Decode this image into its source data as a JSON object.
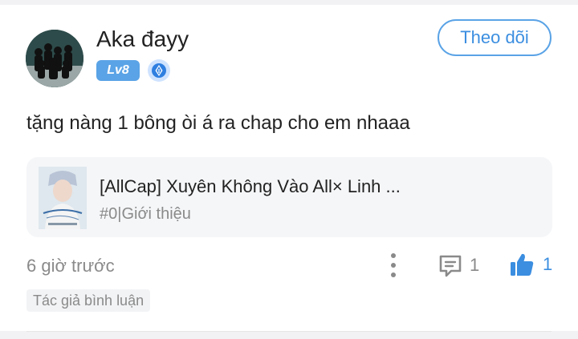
{
  "comment": {
    "username": "Aka đayy",
    "level": "Lv8",
    "follow_label": "Theo dõi",
    "text": "tặng nàng 1 bông òi á ra chap cho em nhaaa",
    "time": "6 giờ trước",
    "reply_count": "1",
    "like_count": "1",
    "author_tag": "Tác giả bình luận"
  },
  "linked_story": {
    "title": "[AllCap] Xuyên Không Vào All× Linh ...",
    "subtitle": "#0|Giới thiệu"
  },
  "icons": {
    "level_badge": "pen-nib-icon",
    "more": "more-vertical-icon",
    "reply": "comment-icon",
    "like": "thumbs-up-icon"
  },
  "colors": {
    "accent": "#3b8ee0",
    "badge": "#5aa3e6",
    "muted_text": "#8a8a8a",
    "card_bg": "#f5f6f8"
  }
}
